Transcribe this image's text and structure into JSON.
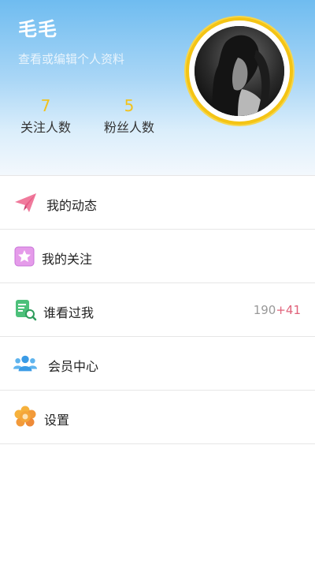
{
  "profile": {
    "name": "毛毛",
    "subtitle": "查看或编辑个人资料",
    "following_count": "7",
    "following_label": "关注人数",
    "fans_count": "5",
    "fans_label": "粉丝人数"
  },
  "menu": [
    {
      "label": "我的动态",
      "icon": "paper-plane-icon"
    },
    {
      "label": "我的关注",
      "icon": "star-icon"
    },
    {
      "label": "谁看过我",
      "icon": "visitors-icon",
      "count": "190",
      "count_new": "+41"
    },
    {
      "label": "会员中心",
      "icon": "group-icon"
    },
    {
      "label": "设置",
      "icon": "settings-flower-icon"
    }
  ],
  "colors": {
    "accent_yellow": "#f2c21c",
    "header_blue": "#6fbcf0",
    "new_count_pink": "#e0627a"
  }
}
